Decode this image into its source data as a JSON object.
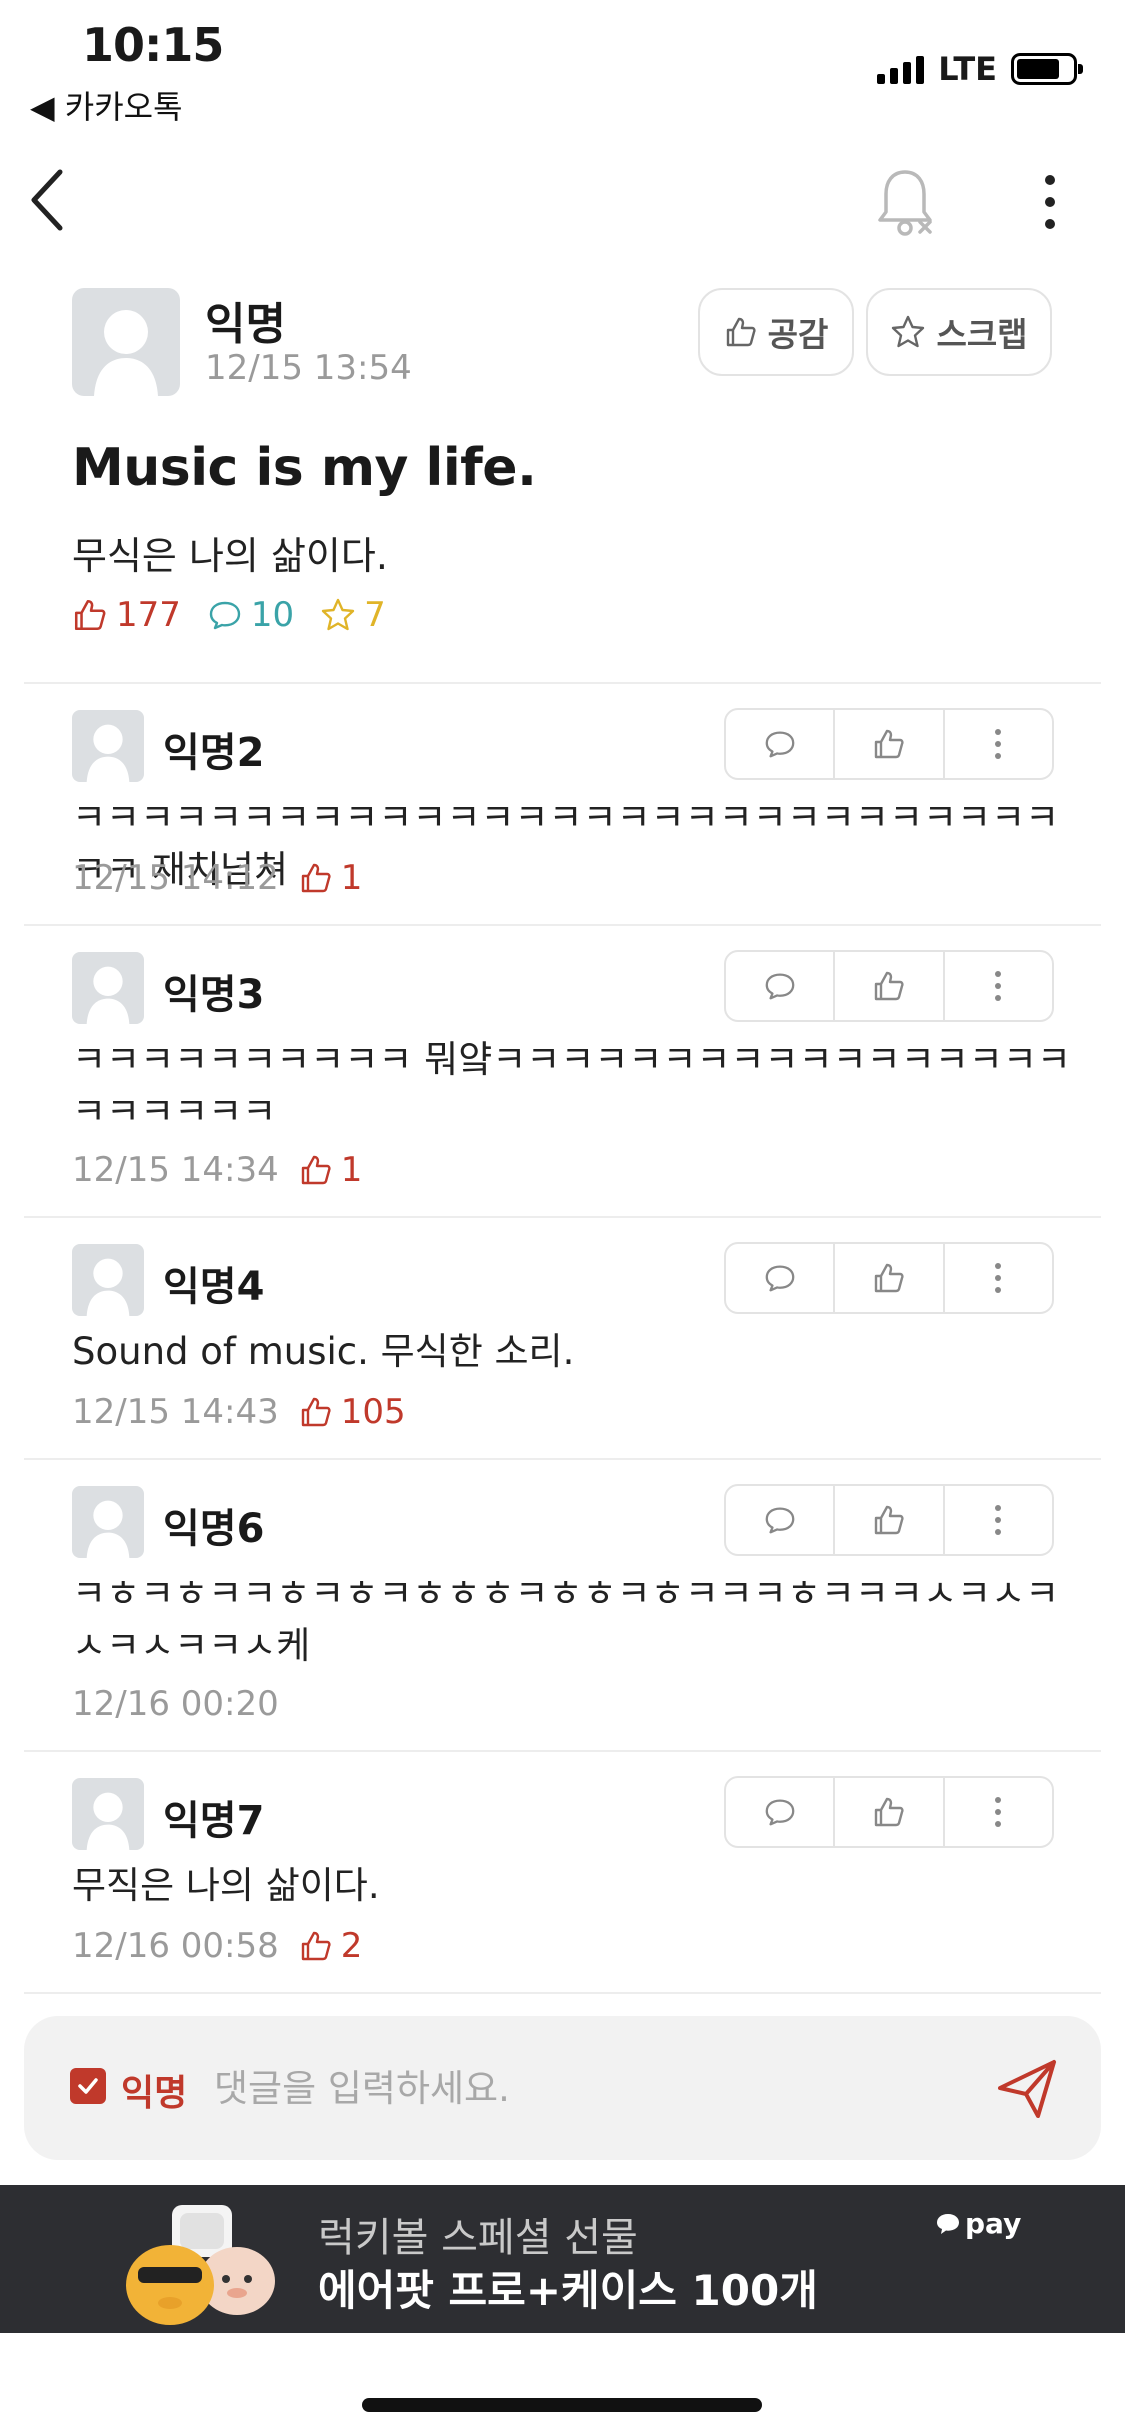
{
  "status_bar": {
    "time": "10:15",
    "back_app": "◀ 카카오톡",
    "network": "LTE",
    "battery_level": 0.8
  },
  "post": {
    "author": "익명",
    "timestamp": "12/15 13:54",
    "like_button": "공감",
    "scrap_button": "스크랩",
    "title": "Music is my life.",
    "body": "무식은 나의 삶이다.",
    "likes": "177",
    "comments": "10",
    "scraps": "7"
  },
  "comments": [
    {
      "author": "익명2",
      "text": "ㅋㅋㅋㅋㅋㅋㅋㅋㅋㅋㅋㅋㅋㅋㅋㅋㅋㅋㅋㅋㅋㅋㅋㅋㅋㅋㅋㅋㅋㅋㅋ 재치넘쳐",
      "time": "12/15 14:12",
      "likes": "1"
    },
    {
      "author": "익명3",
      "text": "ㅋㅋㅋㅋㅋㅋㅋㅋㅋㅋ 뭐얔ㅋㅋㅋㅋㅋㅋㅋㅋㅋㅋㅋㅋㅋㅋㅋㅋㅋㅋㅋㅋㅋㅋㅋ",
      "time": "12/15 14:34",
      "likes": "1"
    },
    {
      "author": "익명4",
      "text": "Sound of music. 무식한 소리.",
      "time": "12/15 14:43",
      "likes": "105"
    },
    {
      "author": "익명6",
      "text": "ㅋㅎㅋㅎㅋㅋㅎㅋㅎㅋㅎㅎㅎㅋㅎㅎㅋㅎㅋㅋㅋㅎㅋㅋㅋㅅㅋㅅㅋㅅㅋㅅㅋㅋㅅ케",
      "time": "12/16 00:20",
      "likes": ""
    },
    {
      "author": "익명7",
      "text": "무직은 나의 삶이다.",
      "time": "12/16 00:58",
      "likes": "2"
    }
  ],
  "comment_input": {
    "anonymous_label": "익명",
    "anonymous_checked": true,
    "placeholder": "댓글을 입력하세요."
  },
  "ad": {
    "line1": "럭키볼 스페셜 선물",
    "line2": "에어팟 프로+케이스 100개",
    "brand": "pay"
  },
  "colors": {
    "accent": "#c0392b",
    "comment_count": "#3aa3a8",
    "scrap_count": "#e0b428",
    "ad_background": "#2d2e32"
  }
}
